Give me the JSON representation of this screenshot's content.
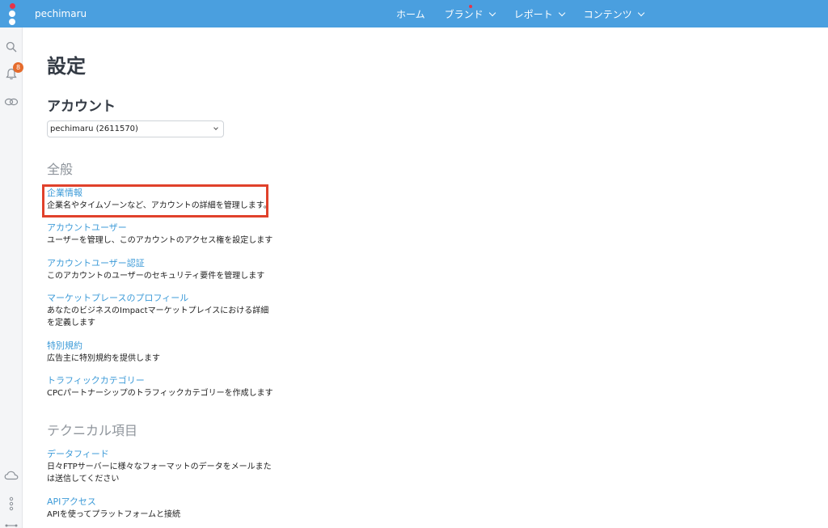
{
  "topbar": {
    "account_name": "pechimaru",
    "nav": [
      {
        "label": "ホーム"
      },
      {
        "label": "ブランド"
      },
      {
        "label": "レポート"
      },
      {
        "label": "コンテンツ"
      }
    ]
  },
  "sidebar": {
    "notification_count": "8"
  },
  "page": {
    "title": "設定",
    "account_heading": "アカウント",
    "account_select_value": "pechimaru (2611570)"
  },
  "general": {
    "heading": "全般",
    "items": [
      {
        "link": "企業情報",
        "desc": "企業名やタイムゾーンなど、アカウントの詳細を管理します。"
      },
      {
        "link": "アカウントユーザー",
        "desc": "ユーザーを管理し、このアカウントのアクセス権を設定します"
      },
      {
        "link": "アカウントユーザー認証",
        "desc": "このアカウントのユーザーのセキュリティ要件を管理します"
      },
      {
        "link": "マーケットプレースのプロフィール",
        "desc": "あなたのビジネスのImpactマーケットプレイスにおける詳細を定義します"
      },
      {
        "link": "特別規約",
        "desc": "広告主に特別規約を提供します"
      },
      {
        "link": "トラフィックカテゴリー",
        "desc": "CPCパートナーシップのトラフィックカテゴリーを作成します"
      }
    ]
  },
  "technical": {
    "heading": "テクニカル項目",
    "items": [
      {
        "link": "データフィード",
        "desc": "日々FTPサーバーに様々なフォーマットのデータをメールまたは送信してください"
      },
      {
        "link": "APIアクセス",
        "desc": "APIを使ってプラットフォームと接続"
      }
    ]
  },
  "colors": {
    "topbar": "#4a9fdf",
    "link": "#3d9bd8",
    "highlight_border": "#e0412b",
    "badge": "#e56b2c"
  }
}
